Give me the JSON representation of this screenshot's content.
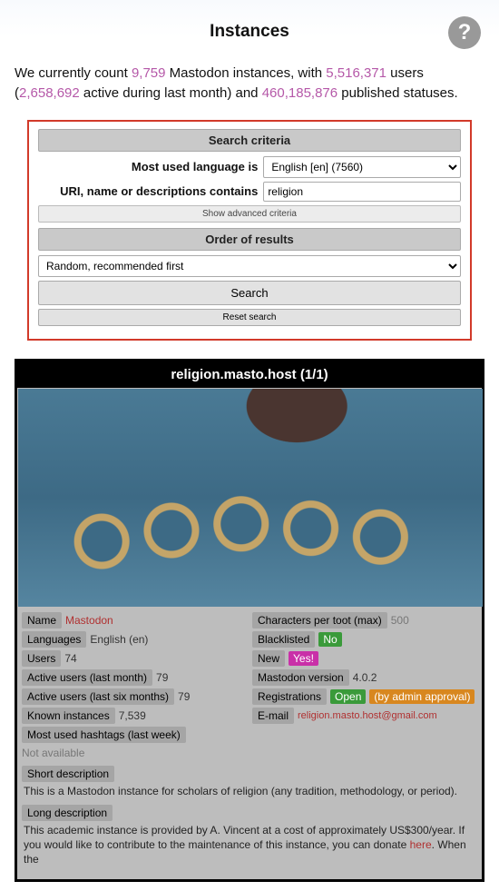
{
  "header": {
    "title": "Instances"
  },
  "intro": {
    "t1": "We currently count ",
    "instance_count": "9,759",
    "t2": " Mastodon instances, with ",
    "user_count": "5,516,371",
    "t3": " users (",
    "active_users": "2,658,692",
    "t4": " active during last month) and ",
    "statuses": "460,185,876",
    "t5": " published statuses."
  },
  "search": {
    "criteria_title": "Search criteria",
    "lang_label": "Most used language is",
    "lang_value": "English [en] (7560)",
    "contains_label": "URI, name or descriptions contains",
    "contains_value": "religion",
    "advanced": "Show advanced criteria",
    "order_title": "Order of results",
    "order_value": "Random, recommended first",
    "search_btn": "Search",
    "reset_btn": "Reset search"
  },
  "result": {
    "title": "religion.masto.host (1/1)",
    "left": {
      "name_label": "Name",
      "name_value": "Mastodon",
      "langs_label": "Languages",
      "langs_value": "English (en)",
      "users_label": "Users",
      "users_value": "74",
      "aum_label": "Active users (last month)",
      "aum_value": "79",
      "au6_label": "Active users (last six months)",
      "au6_value": "79",
      "known_label": "Known instances",
      "known_value": "7,539",
      "hashtags_label": "Most used hashtags (last week)",
      "hashtags_value": "Not available"
    },
    "right": {
      "chars_label": "Characters per toot (max)",
      "chars_value": "500",
      "black_label": "Blacklisted",
      "black_value": "No",
      "new_label": "New",
      "new_value": "Yes!",
      "ver_label": "Mastodon version",
      "ver_value": "4.0.2",
      "reg_label": "Registrations",
      "reg_value": "Open",
      "reg_extra": "(by admin approval)",
      "email_label": "E-mail",
      "email_value": "religion.masto.host@gmail.com"
    },
    "short_label": "Short description",
    "short_text": "This is a Mastodon instance for scholars of religion (any tradition, methodology, or period).",
    "long_label": "Long description",
    "long_text_1": "This academic instance is provided by A. Vincent at a cost of approximately US$300/year. If you would like to contribute to the maintenance of this instance, you can donate ",
    "long_here": "here",
    "long_text_2": ". When the"
  }
}
